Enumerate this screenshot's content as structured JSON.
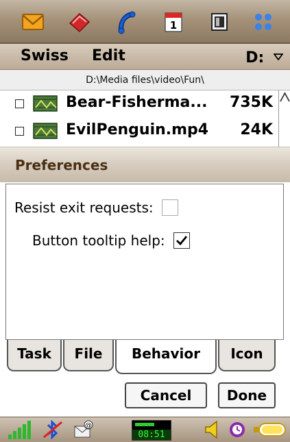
{
  "appbar": {
    "icons": [
      "mail-icon",
      "notes-icon",
      "phone-icon",
      "calendar-icon",
      "media-icon",
      "apps-grid-icon"
    ],
    "colors": {
      "mail": "#f0a020",
      "notes": "#d02828",
      "phone": "#1a5fd6",
      "calendar": "#ffffff",
      "media": "#2a2a2a",
      "grid": "#2a6fd0"
    }
  },
  "menu": {
    "swiss": "Swiss",
    "edit": "Edit",
    "drive": "D:"
  },
  "path": "D:\\Media files\\video\\Fun\\",
  "files": [
    {
      "name": "Bear-Fisherma...",
      "size": "735K"
    },
    {
      "name": "EvilPenguin.mp4",
      "size": "24K"
    }
  ],
  "dialog": {
    "title": "Preferences",
    "options": [
      {
        "label": "Resist exit requests:",
        "checked": false
      },
      {
        "label": "Button tooltip help:",
        "checked": true
      }
    ]
  },
  "tabs": [
    "Task",
    "File",
    "Behavior",
    "Icon"
  ],
  "active_tab": "Behavior",
  "buttons": {
    "cancel": "Cancel",
    "done": "Done"
  },
  "status": {
    "time": "08:51",
    "icons": [
      "signal-icon",
      "bluetooth-icon",
      "email-alert-icon",
      "clock-icon",
      "volume-icon",
      "alarm-icon",
      "battery-icon"
    ]
  }
}
